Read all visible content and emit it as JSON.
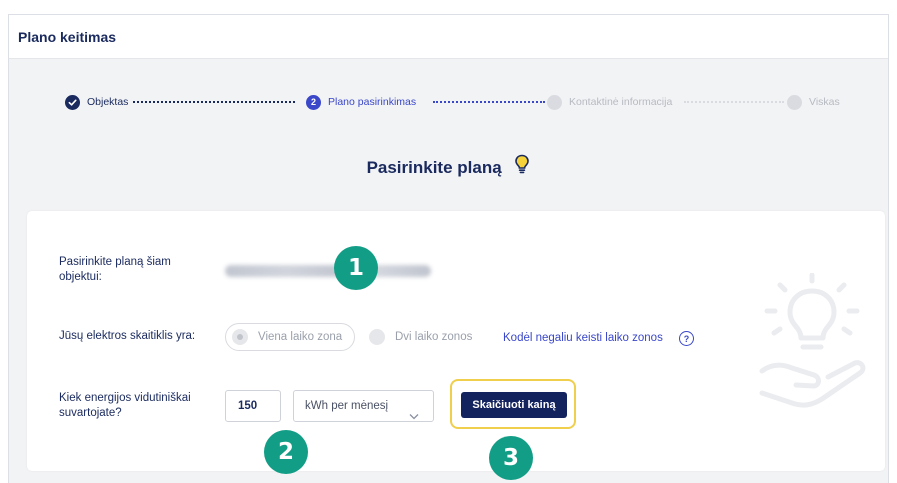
{
  "header": {
    "title": "Plano keitimas"
  },
  "stepper": {
    "steps": [
      {
        "label": "Objektas",
        "state": "done",
        "number": ""
      },
      {
        "label": "Plano pasirinkimas",
        "state": "active",
        "number": "2"
      },
      {
        "label": "Kontaktinė informacija",
        "state": "todo",
        "number": ""
      },
      {
        "label": "Viskas",
        "state": "todo",
        "number": ""
      }
    ]
  },
  "main": {
    "title": "Pasirinkite planą",
    "title_icon": "lightbulb-icon"
  },
  "form": {
    "object_label": "Pasirinkite planą šiam objektui:",
    "meter_label": "Jūsų elektros skaitiklis yra:",
    "meter_options": [
      {
        "label": "Viena laiko zona",
        "selected": true
      },
      {
        "label": "Dvi laiko zonos",
        "selected": false
      }
    ],
    "why_link": "Kodėl negaliu keisti laiko zonos",
    "consumption_label": "Kiek energijos vidutiniškai suvartojate?",
    "consumption_value": "150",
    "unit_selected": "kWh per mėnesį",
    "calculate_button": "Skaičiuoti kainą"
  },
  "markers": [
    "1",
    "2",
    "3"
  ],
  "colors": {
    "brand_navy": "#13235e",
    "link_blue": "#3a47c9",
    "marker_teal": "#129d86",
    "highlight_yellow": "#f0cf4c"
  }
}
